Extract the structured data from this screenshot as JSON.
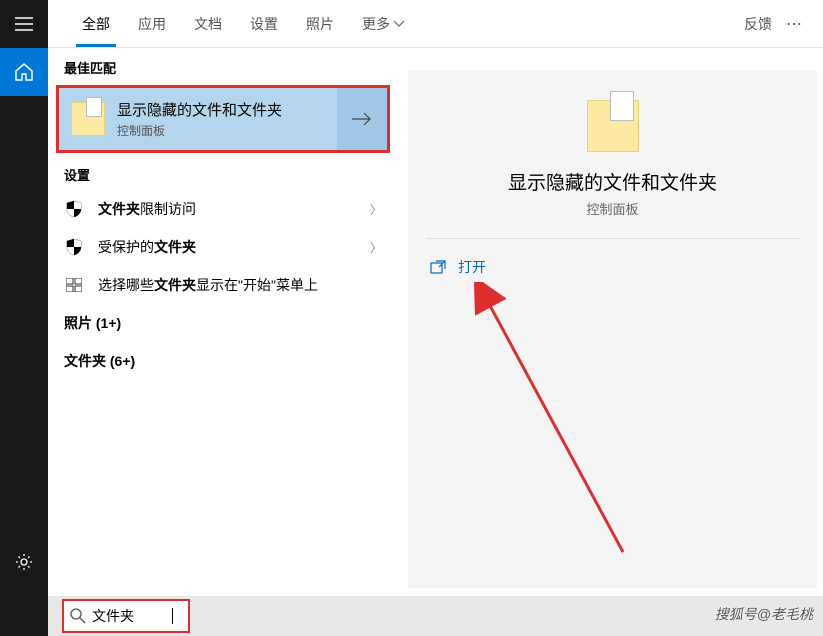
{
  "tabs": {
    "all": "全部",
    "apps": "应用",
    "docs": "文档",
    "settings": "设置",
    "photos": "照片",
    "more": "更多"
  },
  "topbar": {
    "feedback": "反馈"
  },
  "sections": {
    "best_match": "最佳匹配",
    "settings": "设置"
  },
  "best_match": {
    "title": "显示隐藏的文件和文件夹",
    "subtitle": "控制面板"
  },
  "settings_items": [
    {
      "bold": "文件夹",
      "rest": "限制访问",
      "icon": "shield"
    },
    {
      "bold": "",
      "rest": "受保护的文件夹",
      "icon": "shield",
      "prefix_bold": false,
      "full_bold_prefix": "",
      "label_html": "受保护的<b>文件夹</b>"
    },
    {
      "bold": "",
      "rest": "选择哪些文件夹显示在\"开始\"菜单上",
      "icon": "grid",
      "no_chevron": true
    }
  ],
  "categories": {
    "photos": "照片 (1+)",
    "folders": "文件夹 (6+)"
  },
  "preview": {
    "title": "显示隐藏的文件和文件夹",
    "subtitle": "控制面板",
    "open": "打开"
  },
  "search": {
    "value": "文件夹"
  },
  "watermark": "搜狐号@老毛桃"
}
